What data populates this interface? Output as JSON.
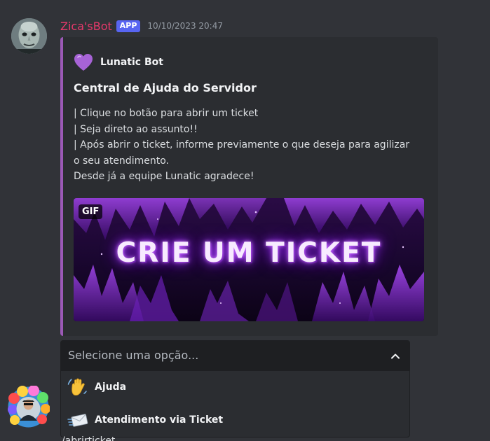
{
  "message": {
    "username": "Zica'sBot",
    "badge": "APP",
    "timestamp": "10/10/2023 20:47",
    "username_color": "#e8386b"
  },
  "embed": {
    "accent_color": "#9b59b6",
    "author_icon": "purple-heart-icon",
    "author_name": "Lunatic Bot",
    "title": "Central de Ajuda do Servidor",
    "description_lines": [
      "| Clique no botão para abrir um ticket",
      "| Seja direto ao assunto!!",
      "| Após abrir o ticket, informe previamente o que deseja para agilizar",
      "o seu atendimento.",
      "Desde já a equipe Lunatic agradece!"
    ],
    "image": {
      "badge": "GIF",
      "text": "CRIE UM TICKET"
    }
  },
  "select_menu": {
    "placeholder": "Selecione uma opção...",
    "chevron_icon": "chevron-up-icon",
    "options": [
      {
        "emoji": "waving-hand-icon",
        "label": "Ajuda"
      },
      {
        "emoji": "incoming-envelope-icon",
        "label": "Atendimento via Ticket"
      }
    ]
  },
  "next_message": {
    "text_partial": "/abrirticket"
  }
}
